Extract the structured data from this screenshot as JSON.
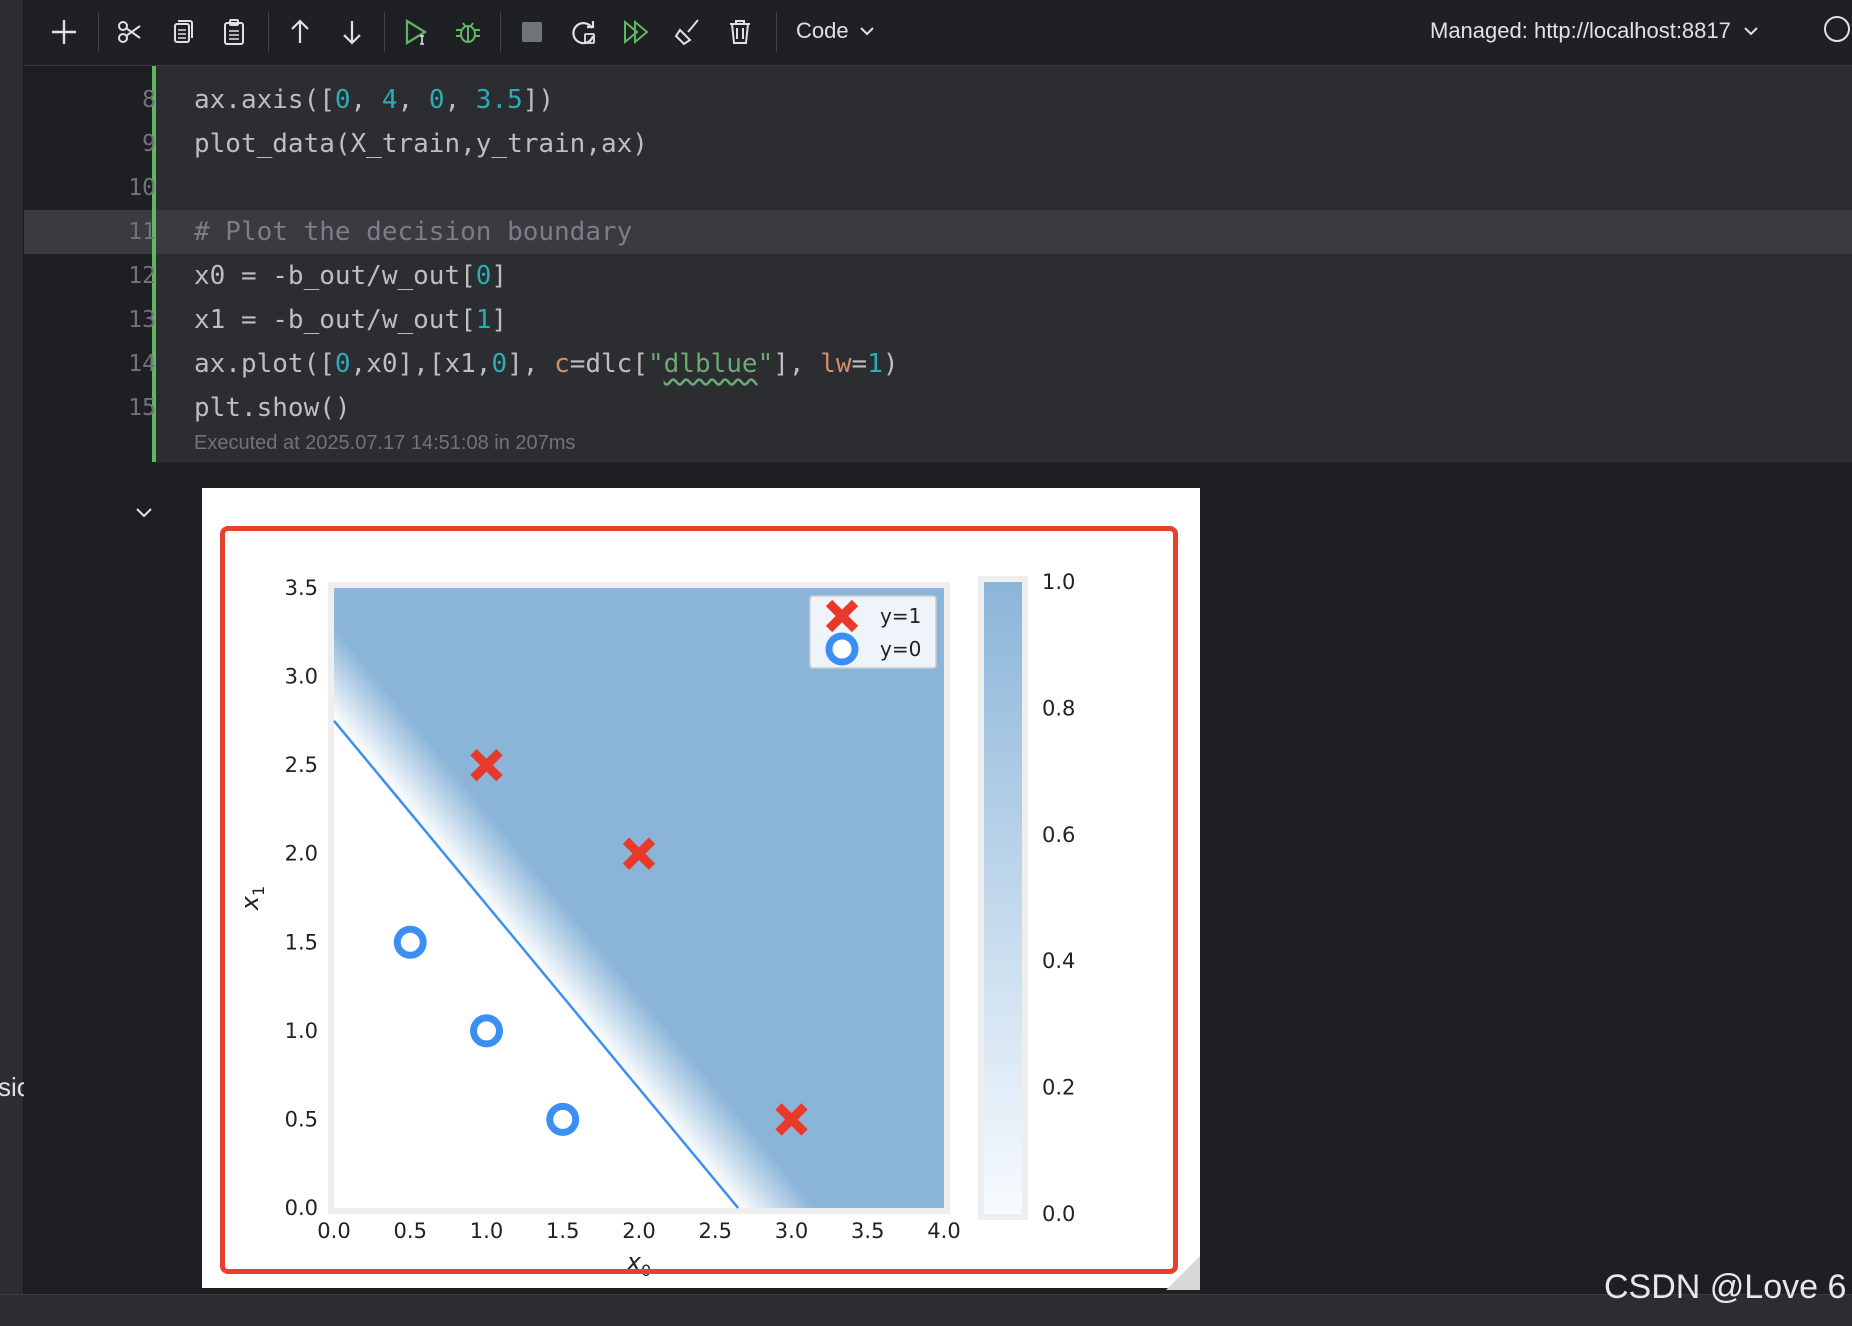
{
  "toolbar": {
    "cell_type": "Code",
    "server": "Managed: http://localhost:8817",
    "kernel_partial": "P"
  },
  "code_lines": [
    {
      "num": "8",
      "text": "ax.axis([0, 4, 0, 3.5])"
    },
    {
      "num": "9",
      "text": "plot_data(X_train,y_train,ax)"
    },
    {
      "num": "10",
      "text": ""
    },
    {
      "num": "11",
      "text": "# Plot the decision boundary"
    },
    {
      "num": "12",
      "text": "x0 = -b_out/w_out[0]"
    },
    {
      "num": "13",
      "text": "x1 = -b_out/w_out[1]"
    },
    {
      "num": "14",
      "text": "ax.plot([0,x0],[x1,0], c=dlc[\"dlblue\"], lw=1)"
    },
    {
      "num": "15",
      "text": "plt.show()"
    }
  ],
  "exec_info": "Executed at 2025.07.17 14:51:08 in 207ms",
  "left_strip_text": "sio",
  "watermark": "CSDN @Love 6",
  "colors": {
    "accent_green": "#5fb85f",
    "red_frame": "#e8402e",
    "dlblue": "#3b8ff2",
    "dlred": "#e8392a",
    "fill_blue": "#8bb5d8"
  },
  "chart_data": {
    "type": "scatter",
    "xlabel": "x0",
    "ylabel": "x1",
    "xlim": [
      0,
      4
    ],
    "ylim": [
      0,
      3.5
    ],
    "xticks": [
      "0.0",
      "0.5",
      "1.0",
      "1.5",
      "2.0",
      "2.5",
      "3.0",
      "3.5",
      "4.0"
    ],
    "yticks": [
      "0.0",
      "0.5",
      "1.0",
      "1.5",
      "2.0",
      "2.5",
      "3.0",
      "3.5"
    ],
    "series": [
      {
        "name": "y=1",
        "marker": "x",
        "color": "#e8392a",
        "points": [
          [
            1.0,
            2.5
          ],
          [
            2.0,
            2.0
          ],
          [
            3.0,
            0.5
          ]
        ]
      },
      {
        "name": "y=0",
        "marker": "o",
        "color": "#3b8ff2",
        "points": [
          [
            0.5,
            1.5
          ],
          [
            1.0,
            1.0
          ],
          [
            1.5,
            0.5
          ]
        ]
      }
    ],
    "decision_boundary": {
      "x": [
        0,
        2.65
      ],
      "y": [
        2.75,
        0
      ],
      "color": "#3b8ff2"
    },
    "colorbar": {
      "ticks": [
        "0.0",
        "0.2",
        "0.4",
        "0.6",
        "0.8",
        "1.0"
      ],
      "range": [
        0,
        1
      ]
    },
    "legend_position": "top-right"
  }
}
